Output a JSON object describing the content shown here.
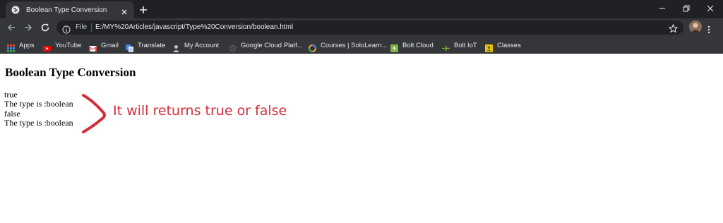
{
  "tab": {
    "title": "Boolean Type Conversion"
  },
  "omnibox": {
    "scheme_label": "File",
    "url": "E:/MY%20Articles/javascript/Type%20Conversion/boolean.html"
  },
  "bookmarks": [
    {
      "label": "Apps",
      "icon": "apps-grid-icon",
      "color": "#ea4335"
    },
    {
      "label": "YouTube",
      "icon": "youtube-icon",
      "color": "#ff0000"
    },
    {
      "label": "Gmail",
      "icon": "gmail-icon",
      "color": "#ea4335"
    },
    {
      "label": "Translate",
      "icon": "translate-icon",
      "color": "#4285f4"
    },
    {
      "label": "My Account",
      "icon": "account-icon",
      "color": "#bdc1c6"
    },
    {
      "label": "Google Cloud Platf...",
      "icon": "cloud-icon",
      "color": "#5f6368"
    },
    {
      "label": "Courses | SoloLearn...",
      "icon": "sololearn-icon",
      "color": "#e8a33d"
    },
    {
      "label": "Bolt Cloud",
      "icon": "bolt-cloud-icon",
      "color": "#7cb342"
    },
    {
      "label": "Bolt IoT",
      "icon": "bolt-iot-icon",
      "color": "#7cb342"
    },
    {
      "label": "Classes",
      "icon": "classes-icon",
      "color": "#fbbc04"
    }
  ],
  "page": {
    "heading": "Boolean Type Conversion",
    "output": [
      "true",
      "The type is :boolean",
      "false",
      "The type is :boolean"
    ],
    "annotation": "It will returns true or false",
    "annotation_color": "#d32f3a"
  }
}
